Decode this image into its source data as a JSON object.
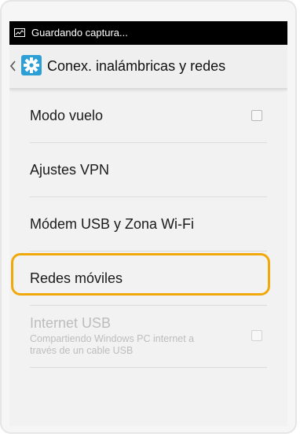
{
  "status_bar": {
    "text": "Guardando captura..."
  },
  "action_bar": {
    "title": "Conex. inalámbricas y redes"
  },
  "items": [
    {
      "label": "Modo vuelo",
      "has_checkbox": true,
      "checked": false
    },
    {
      "label": "Ajustes VPN"
    },
    {
      "label": "Módem USB y Zona Wi-Fi"
    },
    {
      "label": "Redes móviles"
    },
    {
      "label": "Internet USB",
      "summary": "Compartiendo Windows PC internet a través de un cable USB",
      "disabled": true,
      "has_checkbox": true,
      "checked": false
    }
  ],
  "colors": {
    "highlight": "#f0a80a",
    "status_bar_bg": "#000000",
    "settings_icon": "#33b5e5"
  }
}
